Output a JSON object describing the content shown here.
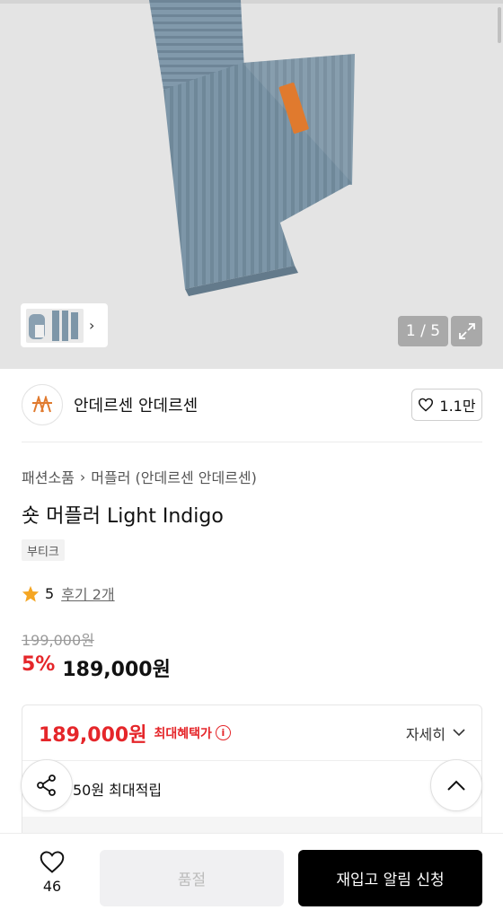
{
  "hero": {
    "counter": "1 / 5",
    "accent_label_color": "#e07a2e",
    "scarf_color": "#7d96a8"
  },
  "brand": {
    "name": "안데르센 안데르센",
    "likes": "1.1만"
  },
  "product": {
    "breadcrumb": [
      "패션소품",
      "머플러 (안데르센 안데르센)"
    ],
    "title": "숏 머플러 Light Indigo",
    "tag": "부티크",
    "rating": "5",
    "reviews": "후기 2개",
    "original_price": "199,000원",
    "discount": "5%",
    "sale_price": "189,000원"
  },
  "benefit": {
    "best_price": "189,000원",
    "best_label": "최대혜택가",
    "detail_label": "자세히",
    "points": "50원 최대적립"
  },
  "bottom": {
    "wish_count": "46",
    "soldout_label": "품절",
    "restock_label": "재입고 알림 신청"
  },
  "colors": {
    "accent_red": "#e5262a",
    "star": "#f5a623"
  }
}
